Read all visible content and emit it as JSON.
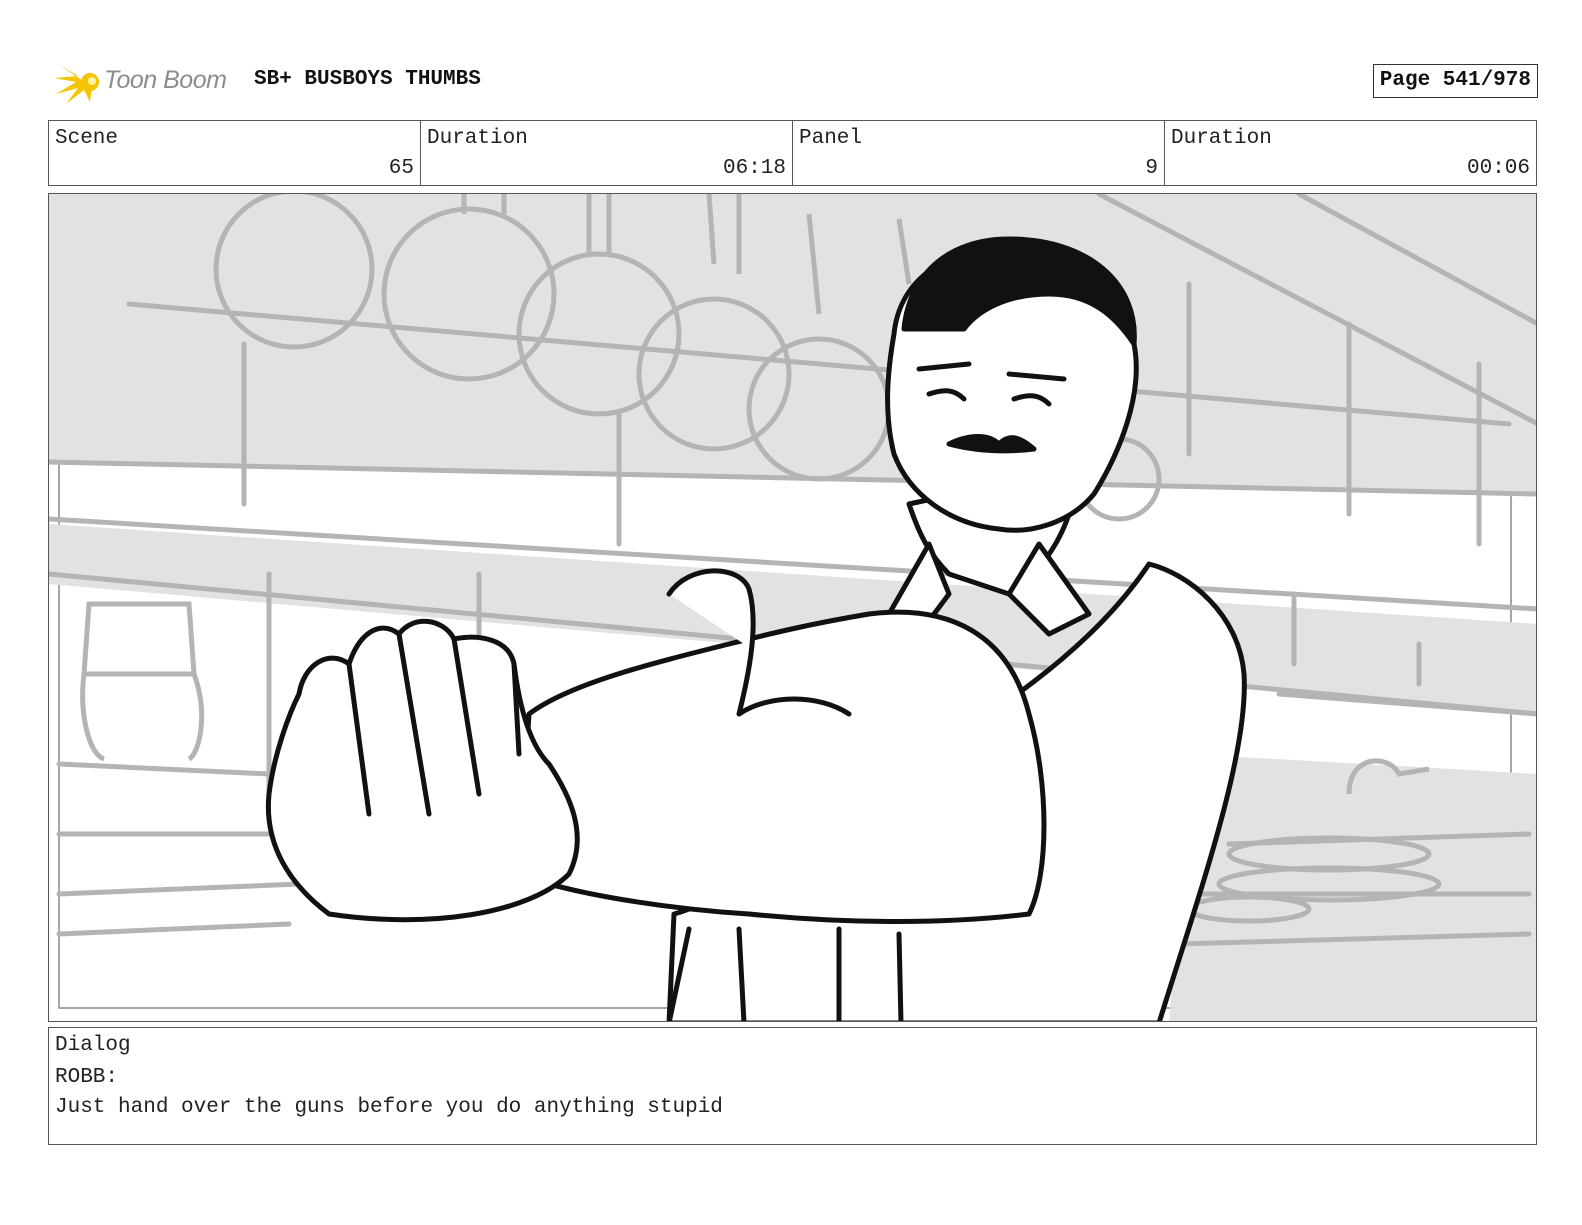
{
  "header": {
    "logo_text": "Toon Boom",
    "project_title": "SB+ BUSBOYS THUMBS",
    "page_label": "Page 541/978"
  },
  "info": {
    "scene_label": "Scene",
    "scene_value": "65",
    "scene_duration_label": "Duration",
    "scene_duration_value": "06:18",
    "panel_label": "Panel",
    "panel_value": "9",
    "panel_duration_label": "Duration",
    "panel_duration_value": "00:06"
  },
  "dialog": {
    "label": "Dialog",
    "speaker": "ROBB:",
    "line": "Just hand over the guns before you do anything stupid"
  },
  "colors": {
    "logo_yellow": "#f5c400",
    "logo_text": "#8c8c8c",
    "sketch_gray": "#b4b4b4",
    "background_gray": "#e2e2e2",
    "ink": "#111111"
  }
}
